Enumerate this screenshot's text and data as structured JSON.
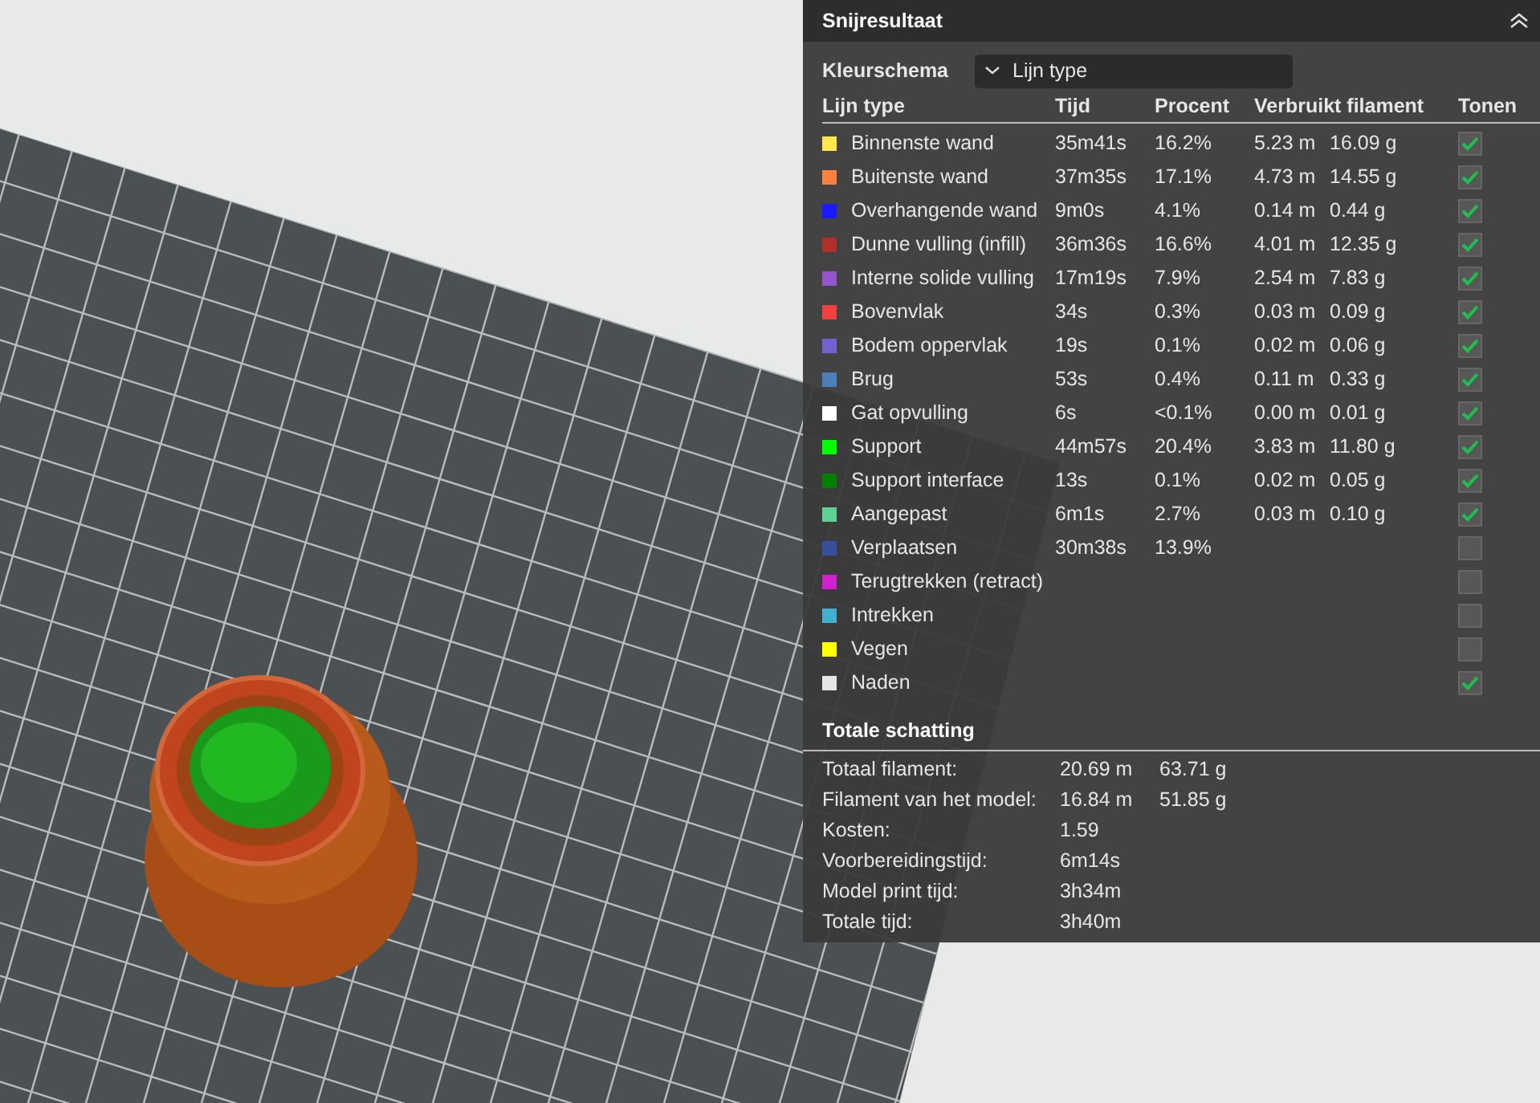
{
  "panel": {
    "title": "Snijresultaat",
    "color_scheme": {
      "label": "Kleurschema",
      "value": "Lijn type"
    },
    "columns": [
      "Lijn type",
      "Tijd",
      "Procent",
      "Verbruikt filament",
      "Tonen"
    ],
    "rows": [
      {
        "color": "#ffe64d",
        "name": "Binnenste wand",
        "time": "35m41s",
        "percent": "16.2%",
        "length": "5.23 m",
        "weight": "16.09 g",
        "checked": true
      },
      {
        "color": "#ff8040",
        "name": "Buitenste wand",
        "time": "37m35s",
        "percent": "17.1%",
        "length": "4.73 m",
        "weight": "14.55 g",
        "checked": true
      },
      {
        "color": "#1a1aff",
        "name": "Overhangende wand",
        "time": "9m0s",
        "percent": "4.1%",
        "length": "0.14 m",
        "weight": "0.44 g",
        "checked": true
      },
      {
        "color": "#b03029",
        "name": "Dunne vulling (infill)",
        "time": "36m36s",
        "percent": "16.6%",
        "length": "4.01 m",
        "weight": "12.35 g",
        "checked": true
      },
      {
        "color": "#9654cc",
        "name": "Interne solide vulling",
        "time": "17m19s",
        "percent": "7.9%",
        "length": "2.54 m",
        "weight": "7.83 g",
        "checked": true
      },
      {
        "color": "#f04040",
        "name": "Bovenvlak",
        "time": "34s",
        "percent": "0.3%",
        "length": "0.03 m",
        "weight": "0.09 g",
        "checked": true
      },
      {
        "color": "#7262d0",
        "name": "Bodem oppervlak",
        "time": "19s",
        "percent": "0.1%",
        "length": "0.02 m",
        "weight": "0.06 g",
        "checked": true
      },
      {
        "color": "#4d80ba",
        "name": "Brug",
        "time": "53s",
        "percent": "0.4%",
        "length": "0.11 m",
        "weight": "0.33 g",
        "checked": true
      },
      {
        "color": "#ffffff",
        "name": "Gat opvulling",
        "time": "6s",
        "percent": "<0.1%",
        "length": "0.00 m",
        "weight": "0.01 g",
        "checked": true
      },
      {
        "color": "#00ff00",
        "name": "Support",
        "time": "44m57s",
        "percent": "20.4%",
        "length": "3.83 m",
        "weight": "11.80 g",
        "checked": true
      },
      {
        "color": "#008000",
        "name": "Support interface",
        "time": "13s",
        "percent": "0.1%",
        "length": "0.02 m",
        "weight": "0.05 g",
        "checked": true
      },
      {
        "color": "#5ed194",
        "name": "Aangepast",
        "time": "6m1s",
        "percent": "2.7%",
        "length": "0.03 m",
        "weight": "0.10 g",
        "checked": true
      },
      {
        "color": "#3a4ea0",
        "name": "Verplaatsen",
        "time": "30m38s",
        "percent": "13.9%",
        "checked": false
      },
      {
        "color": "#d020d0",
        "name": "Terugtrekken (retract)",
        "checked": false
      },
      {
        "color": "#40b0d0",
        "name": "Intrekken",
        "checked": false
      },
      {
        "color": "#ffff00",
        "name": "Vegen",
        "checked": false
      },
      {
        "color": "#e6e6e6",
        "name": "Naden",
        "checked": true
      }
    ],
    "summary": {
      "title": "Totale schatting",
      "rows": [
        {
          "label": "Totaal filament:",
          "value": "20.69 m",
          "value_2": "63.71 g"
        },
        {
          "label": "Filament van het model:",
          "value": "16.84 m",
          "value_2": "51.85 g"
        },
        {
          "label": "Kosten:",
          "value": "1.59"
        },
        {
          "label": "Voorbereidingstijd:",
          "value": "6m14s"
        },
        {
          "label": "Model print tijd:",
          "value": "3h34m"
        },
        {
          "label": "Totale tijd:",
          "value": "3h40m"
        }
      ]
    }
  }
}
